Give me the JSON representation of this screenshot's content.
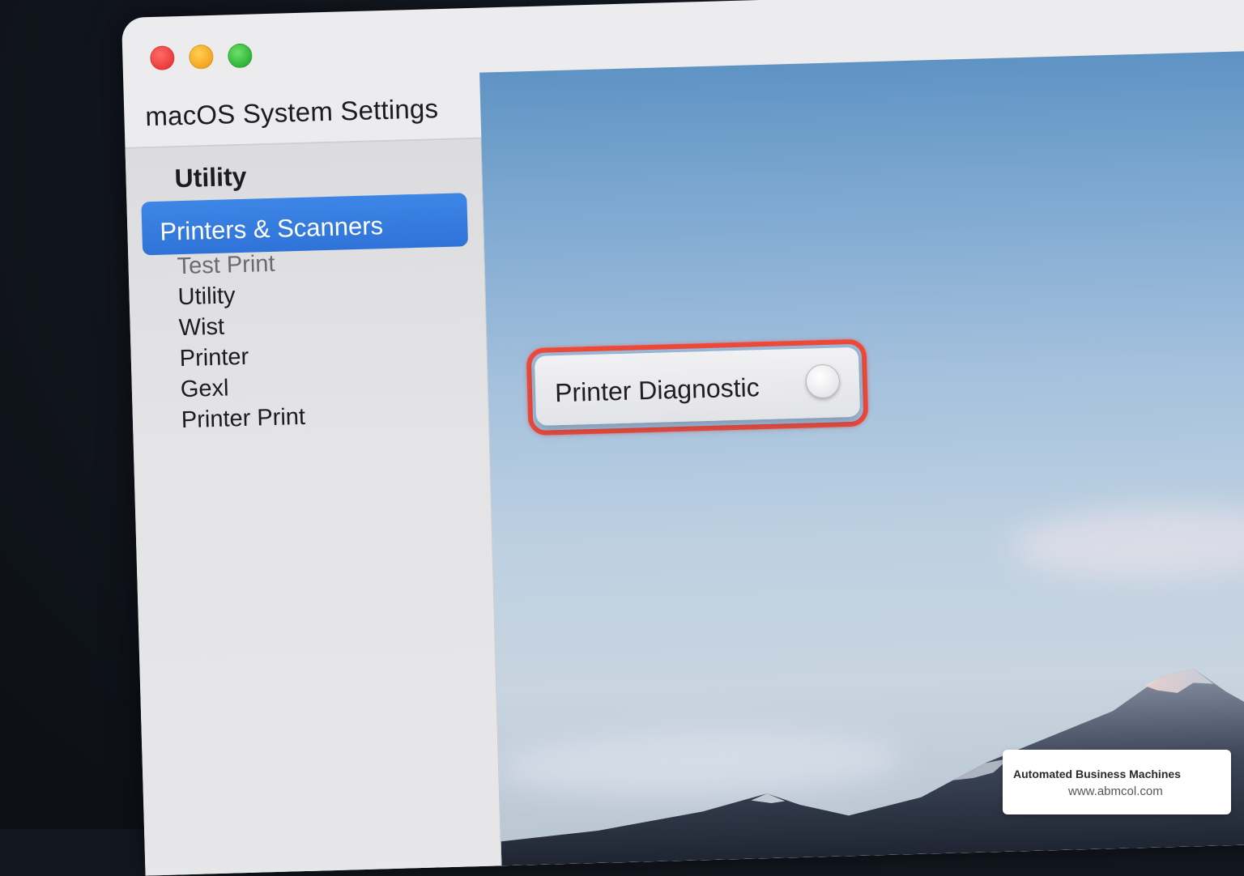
{
  "window": {
    "title": "macOS System Settings"
  },
  "sidebar": {
    "heading": "Utility",
    "selected": "Printers & Scanners",
    "items": [
      {
        "label": "Test Print"
      },
      {
        "label": "Utility"
      },
      {
        "label": "Wist"
      },
      {
        "label": "Printer"
      },
      {
        "label": "Gexl"
      },
      {
        "label": "Printer Print"
      }
    ]
  },
  "content": {
    "diagnostic_label": "Printer Diagnostic",
    "diagnostic_enabled": false
  },
  "watermark": {
    "company": "Automated Business Machines",
    "url": "www.abmcol.com"
  },
  "colors": {
    "selection": "#2f73d8",
    "highlight_ring": "#ee4a3a",
    "close": "#ec3b3b",
    "minimize": "#f3a620",
    "zoom": "#30b43a"
  }
}
